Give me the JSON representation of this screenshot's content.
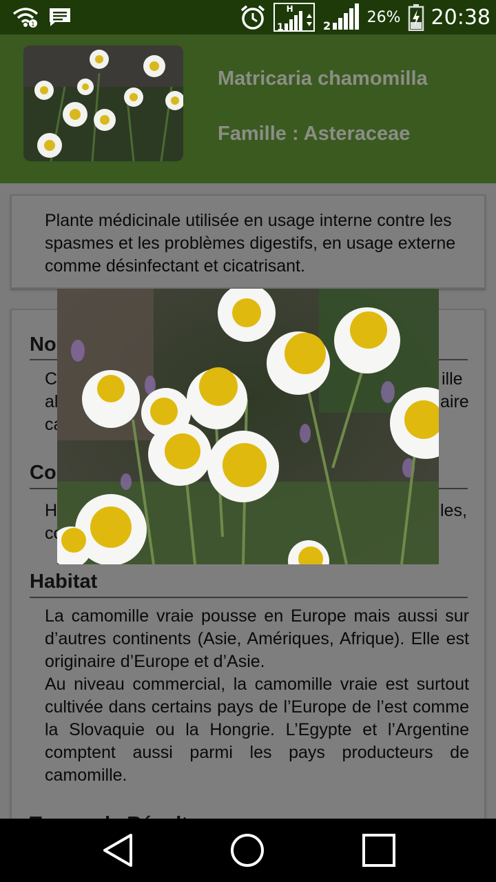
{
  "status_bar": {
    "battery": "26%",
    "time": "20:38",
    "network_label": "H",
    "sim1": "1",
    "sim2": "2",
    "icons": [
      "wifi-icon",
      "message-icon",
      "alarm-icon",
      "signal-icon",
      "battery-charging-icon"
    ]
  },
  "header": {
    "name": "Matricaria chamomilla",
    "family": "Famille : Asteraceae"
  },
  "description": "Plante médicinale utilisée en usage interne contre les spasmes et les problèmes digestifs, en usage externe comme désinfectant et cicatrisant.",
  "sections": {
    "names_partial_title": "No",
    "names_partial_lines": [
      "C",
      "al",
      "ca"
    ],
    "names_partial_right": [
      "ille",
      "aire"
    ],
    "composition_partial_title": "Co",
    "composition_partial_lines": [
      "H",
      "co"
    ],
    "composition_partial_right": [
      "les,"
    ],
    "habitat_title": "Habitat",
    "habitat_p1": "La camomille vraie pousse en Europe mais aussi sur d’autres continents (Asie, Amériques, Afrique). Elle est originaire d’Europe et d’Asie.",
    "habitat_p2": "Au niveau commercial, la camomille vraie est surtout cultivée dans certains pays de l’Europe de l’est comme la Slovaquie ou la Hongrie. L’Egypte et l’Argentine comptent aussi parmi les pays producteurs de camomille.",
    "next_title_partial": "Temps de Récolte"
  },
  "colors": {
    "status_bar": "#1d3a08",
    "header": "#3a5a20",
    "dim_overlay": "#7b7b7b",
    "title_text": "#8b8e85"
  },
  "nav": {
    "icons": [
      "back-icon",
      "home-icon",
      "recents-icon"
    ]
  }
}
